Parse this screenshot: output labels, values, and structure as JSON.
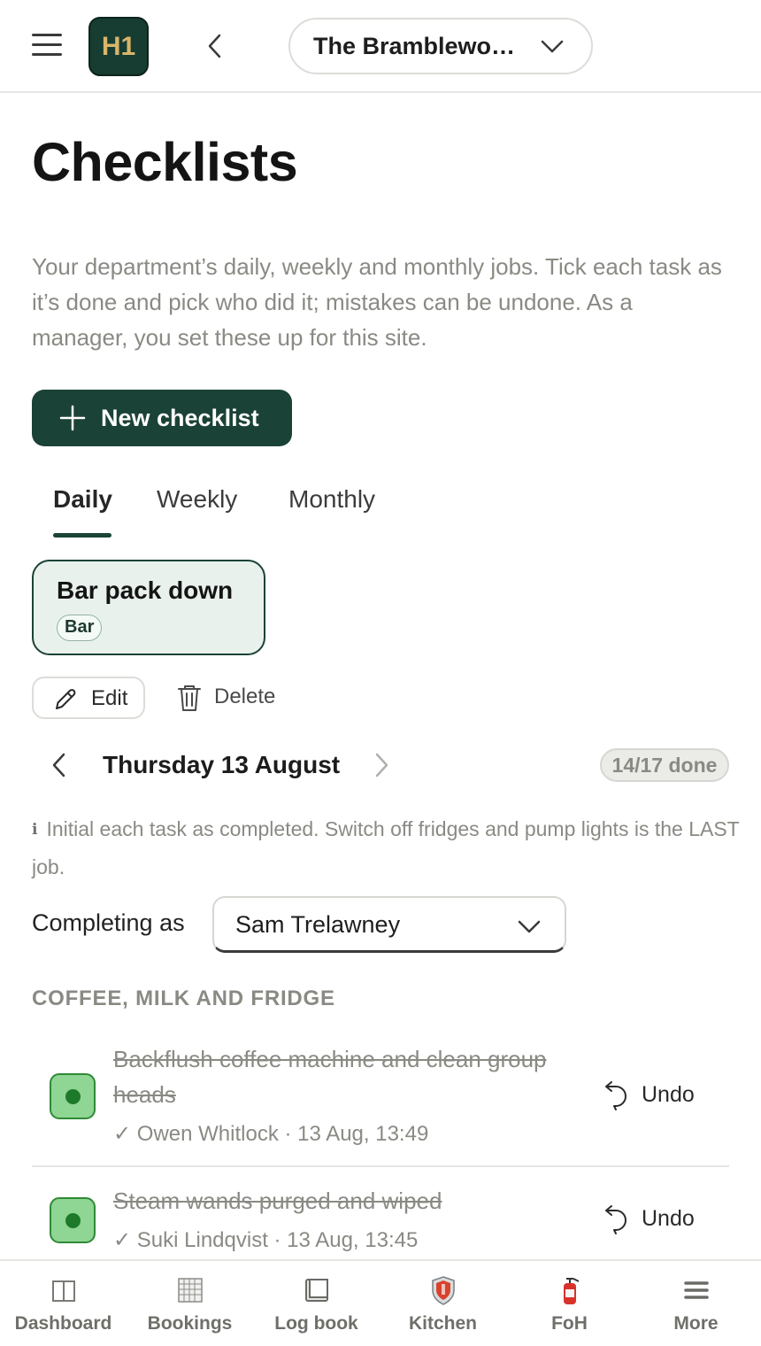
{
  "header": {
    "logo_text": "H1",
    "site_name": "The Bramblewo…"
  },
  "page": {
    "title": "Checklists",
    "intro": "Your department’s daily, weekly and monthly jobs. Tick each task as it’s done and pick who did it; mistakes can be undone. As a manager, you set these up for this site.",
    "new_button_label": "New checklist"
  },
  "tabs": [
    {
      "label": "Daily",
      "active": true
    },
    {
      "label": "Weekly",
      "active": false
    },
    {
      "label": "Monthly",
      "active": false
    }
  ],
  "checklist": {
    "name": "Bar pack down",
    "department": "Bar",
    "edit_label": "Edit",
    "delete_label": "Delete"
  },
  "date_nav": {
    "date": "Thursday 13 August",
    "progress": "14/17 done"
  },
  "note": {
    "icon": "i",
    "text": "Initial each task as completed. Switch off fridges and pump lights is the LAST job."
  },
  "completing": {
    "label": "Completing as",
    "value": "Sam Trelawney"
  },
  "section": {
    "title": "COFFEE, MILK AND FRIDGE",
    "tasks": [
      {
        "title": "Backflush coffee machine and clean group heads",
        "meta": "✓ Owen Whitlock · 13 Aug, 13:49",
        "undo_label": "Undo",
        "done": true
      },
      {
        "title": "Steam wands purged and wiped",
        "meta": "✓ Suki Lindqvist · 13 Aug, 13:45",
        "undo_label": "Undo",
        "done": true
      }
    ]
  },
  "bottom_nav": [
    {
      "label": "Dashboard",
      "icon": "dashboard-icon"
    },
    {
      "label": "Bookings",
      "icon": "bookings-icon"
    },
    {
      "label": "Log book",
      "icon": "logbook-icon"
    },
    {
      "label": "Kitchen",
      "icon": "kitchen-icon"
    },
    {
      "label": "FoH",
      "icon": "fire-extinguisher-icon"
    },
    {
      "label": "More",
      "icon": "more-icon"
    }
  ],
  "colors": {
    "brand_green": "#1b4236",
    "logo_gold": "#d8b56a",
    "done_green": "#8fd593",
    "muted_text": "#8a8a84"
  }
}
